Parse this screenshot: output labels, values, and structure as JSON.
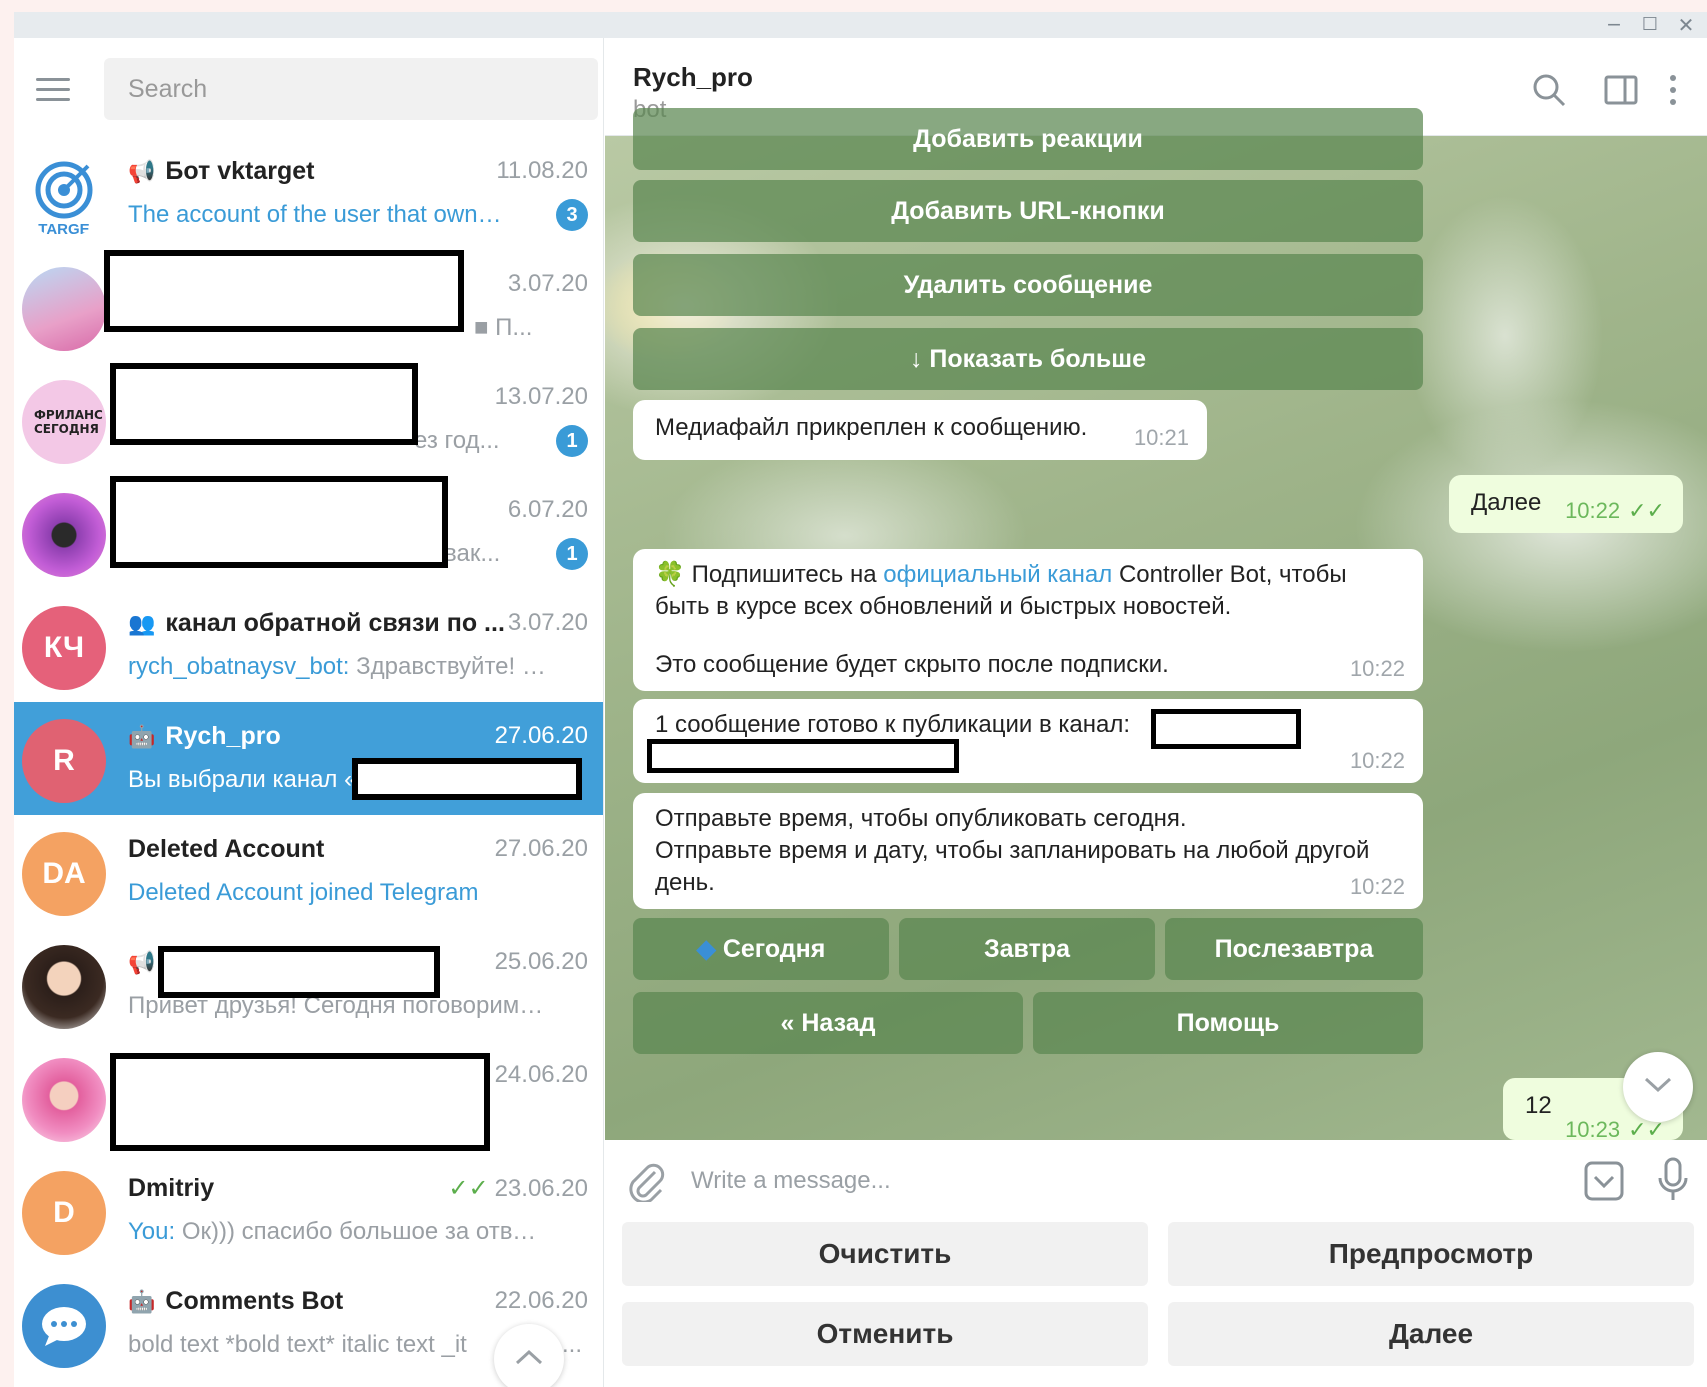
{
  "window": {
    "minimize": "‒",
    "maximize": "☐",
    "close": "✕"
  },
  "search": {
    "placeholder": "Search"
  },
  "chats": [
    {
      "name": "Бот vktarget",
      "time": "11.08.20",
      "preview": "The account of the user that owns t...",
      "badge": "3",
      "avatar_text": "TARGE"
    },
    {
      "name": "",
      "time": "3.07.20",
      "preview": "■ П..."
    },
    {
      "name": "",
      "time": "13.07.20",
      "preview": "ез год...",
      "badge": "1",
      "avatar_text": "ФРИЛАНС СЕГОДНЯ"
    },
    {
      "name": "",
      "time": "6.07.20",
      "preview": "вак...",
      "badge": "1"
    },
    {
      "name": "канал обратной связи по ...",
      "time": "3.07.20",
      "sender": "rych_obatnaysv_bot:",
      "preview": " Здравствуйте! Я с ...",
      "avatar_text": "КЧ"
    },
    {
      "name": "Rych_pro",
      "time": "27.06.20",
      "preview": "Вы выбрали канал «",
      "avatar_text": "R"
    },
    {
      "name": "Deleted Account",
      "time": "27.06.20",
      "preview": "Deleted Account joined Telegram",
      "avatar_text": "DA"
    },
    {
      "name": "",
      "time": "25.06.20",
      "preview": "Привет друзья!  Сегодня поговорим п..."
    },
    {
      "name": "",
      "time": "24.06.20",
      "preview": ""
    },
    {
      "name": "Dmitriy",
      "time": "23.06.20",
      "sender": "You:",
      "preview": " Ок))) спасибо большое за ответ!!!",
      "avatar_text": "D"
    },
    {
      "name": "Comments Bot",
      "time": "22.06.20",
      "preview": "bold text *bold text*  italic text _it",
      "preview_tail": "..."
    }
  ],
  "header": {
    "name": "Rych_pro",
    "status": "bot"
  },
  "messages": {
    "top_buttons": [
      "Добавить реакции",
      "Добавить URL-кнопки",
      "Удалить сообщение",
      "↓ Показать больше"
    ],
    "media_attached": {
      "text": "Медиафайл прикреплен к сообщению.",
      "time": "10:21"
    },
    "out_next": {
      "text": "Далее",
      "time": "10:22"
    },
    "subscribe": {
      "prefix": "Подпишитесь на ",
      "link": "официальный канал",
      "suffix": " Controller Bot, чтобы быть в курсе всех обновлений и быстрых новостей.",
      "note": "Это сообщение будет скрыто после подписки.",
      "time": "10:22"
    },
    "ready": {
      "text": "1 сообщение готово к публикации в канал:",
      "time": "10:22"
    },
    "send_time": {
      "line1": "Отправьте время, чтобы опубликовать сегодня.",
      "line2": "Отправьте время и дату, чтобы запланировать на любой другой день.",
      "time": "10:22"
    },
    "inline_row1": [
      "Сегодня",
      "Завтра",
      "Послезавтра"
    ],
    "inline_row2": [
      "« Назад",
      "Помощь"
    ],
    "out_12": {
      "text": "12",
      "time": "10:23"
    }
  },
  "composer": {
    "placeholder": "Write a message..."
  },
  "reply_keyboard": [
    "Очистить",
    "Предпросмотр",
    "Отменить",
    "Далее"
  ],
  "colors": {
    "accent": "#419fd9",
    "badge": "#3a9bd7",
    "outgoing": "#effdde",
    "keyboard_button": "#5a8750"
  }
}
